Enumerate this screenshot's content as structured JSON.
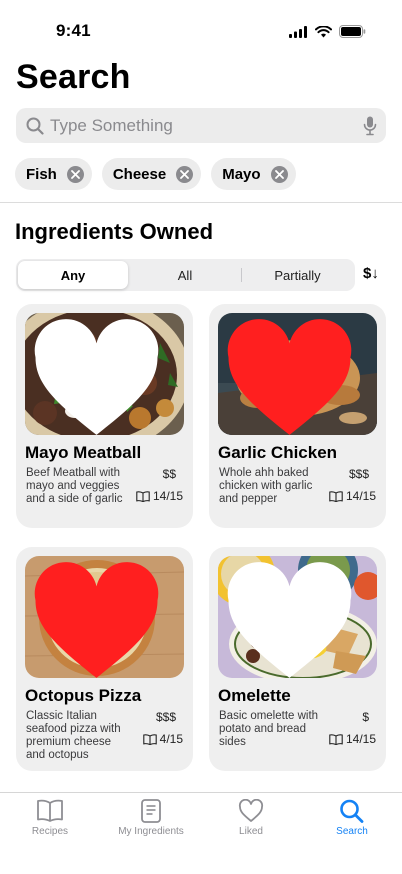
{
  "status_bar": {
    "time": "9:41"
  },
  "page": {
    "title": "Search"
  },
  "search": {
    "placeholder": "Type Something",
    "value": ""
  },
  "filters": {
    "chips": [
      {
        "label": "Fish"
      },
      {
        "label": "Cheese"
      },
      {
        "label": "Mayo"
      }
    ]
  },
  "section": {
    "title": "Ingredients Owned"
  },
  "segments": {
    "options": [
      "Any",
      "All",
      "Partially"
    ],
    "selected": "Any",
    "sort_label": "$↓"
  },
  "recipes": [
    {
      "title": "Mayo Meatball",
      "description": "Beef Meatball with mayo and veggies and a side of garlic",
      "price": "$$",
      "ingredients": "14/15",
      "liked": false,
      "image": "meatball-bowl-image"
    },
    {
      "title": "Garlic Chicken",
      "description": "Whole ahh baked chicken with garlic and pepper",
      "price": "$$$",
      "ingredients": "14/15",
      "liked": true,
      "image": "roast-chicken-image"
    },
    {
      "title": "Octopus Pizza",
      "description": "Classic Italian seafood pizza with premium cheese and octopus",
      "price": "$$$",
      "ingredients": "4/15",
      "liked": true,
      "image": "pizza-image"
    },
    {
      "title": "Omelette",
      "description": "Basic omelette with potato and bread sides",
      "price": "$",
      "ingredients": "14/15",
      "liked": false,
      "image": "omelette-plate-image"
    }
  ],
  "tab_bar": {
    "tabs": [
      {
        "label": "Recipes",
        "icon": "book-icon"
      },
      {
        "label": "My Ingredients",
        "icon": "document-icon"
      },
      {
        "label": "Liked",
        "icon": "heart-icon"
      },
      {
        "label": "Search",
        "icon": "search-icon"
      }
    ],
    "active": "Search"
  },
  "colors": {
    "accent": "#1482f5",
    "liked": "#ff1f1f",
    "card_bg": "#efefef",
    "chip_bg": "#ececec"
  }
}
